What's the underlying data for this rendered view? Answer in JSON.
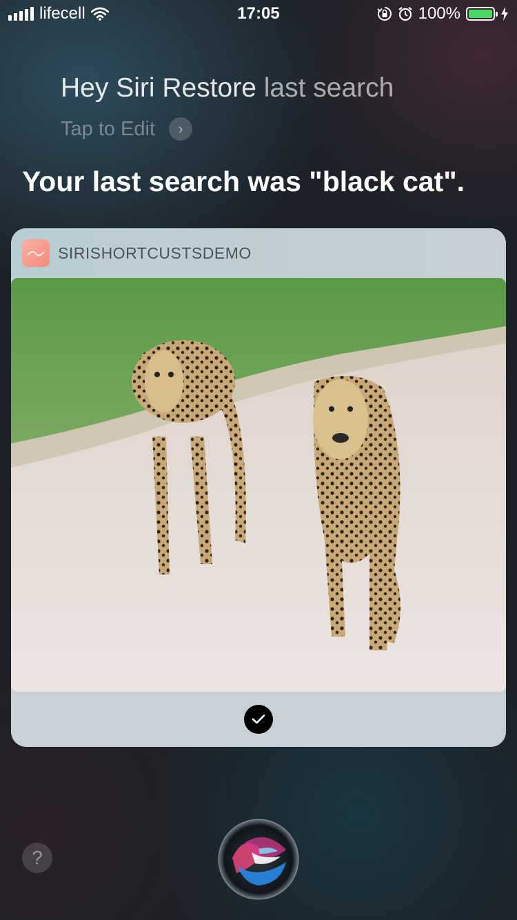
{
  "status_bar": {
    "carrier": "lifecell",
    "time": "17:05",
    "battery_percent": "100%",
    "icons": [
      "signal-icon",
      "wifi-icon",
      "orientation-lock-icon",
      "alarm-icon",
      "battery-icon",
      "charging-icon"
    ]
  },
  "siri": {
    "query_main": "Hey Siri Restore",
    "query_dim": " last search",
    "tap_to_edit": "Tap to Edit",
    "answer": "Your last search was \"black cat\"."
  },
  "card": {
    "app_name": "SIRISHORTCUSTSDEMO",
    "image_description": "photo-two-cheetahs-on-sandy-road",
    "icons": [
      "app-icon",
      "checkmark-icon"
    ]
  },
  "bottom": {
    "help_label": "?",
    "icons": [
      "help-icon",
      "siri-orb-icon"
    ]
  },
  "colors": {
    "battery_green": "#4cd964",
    "card_background": "#c9d1d6"
  }
}
